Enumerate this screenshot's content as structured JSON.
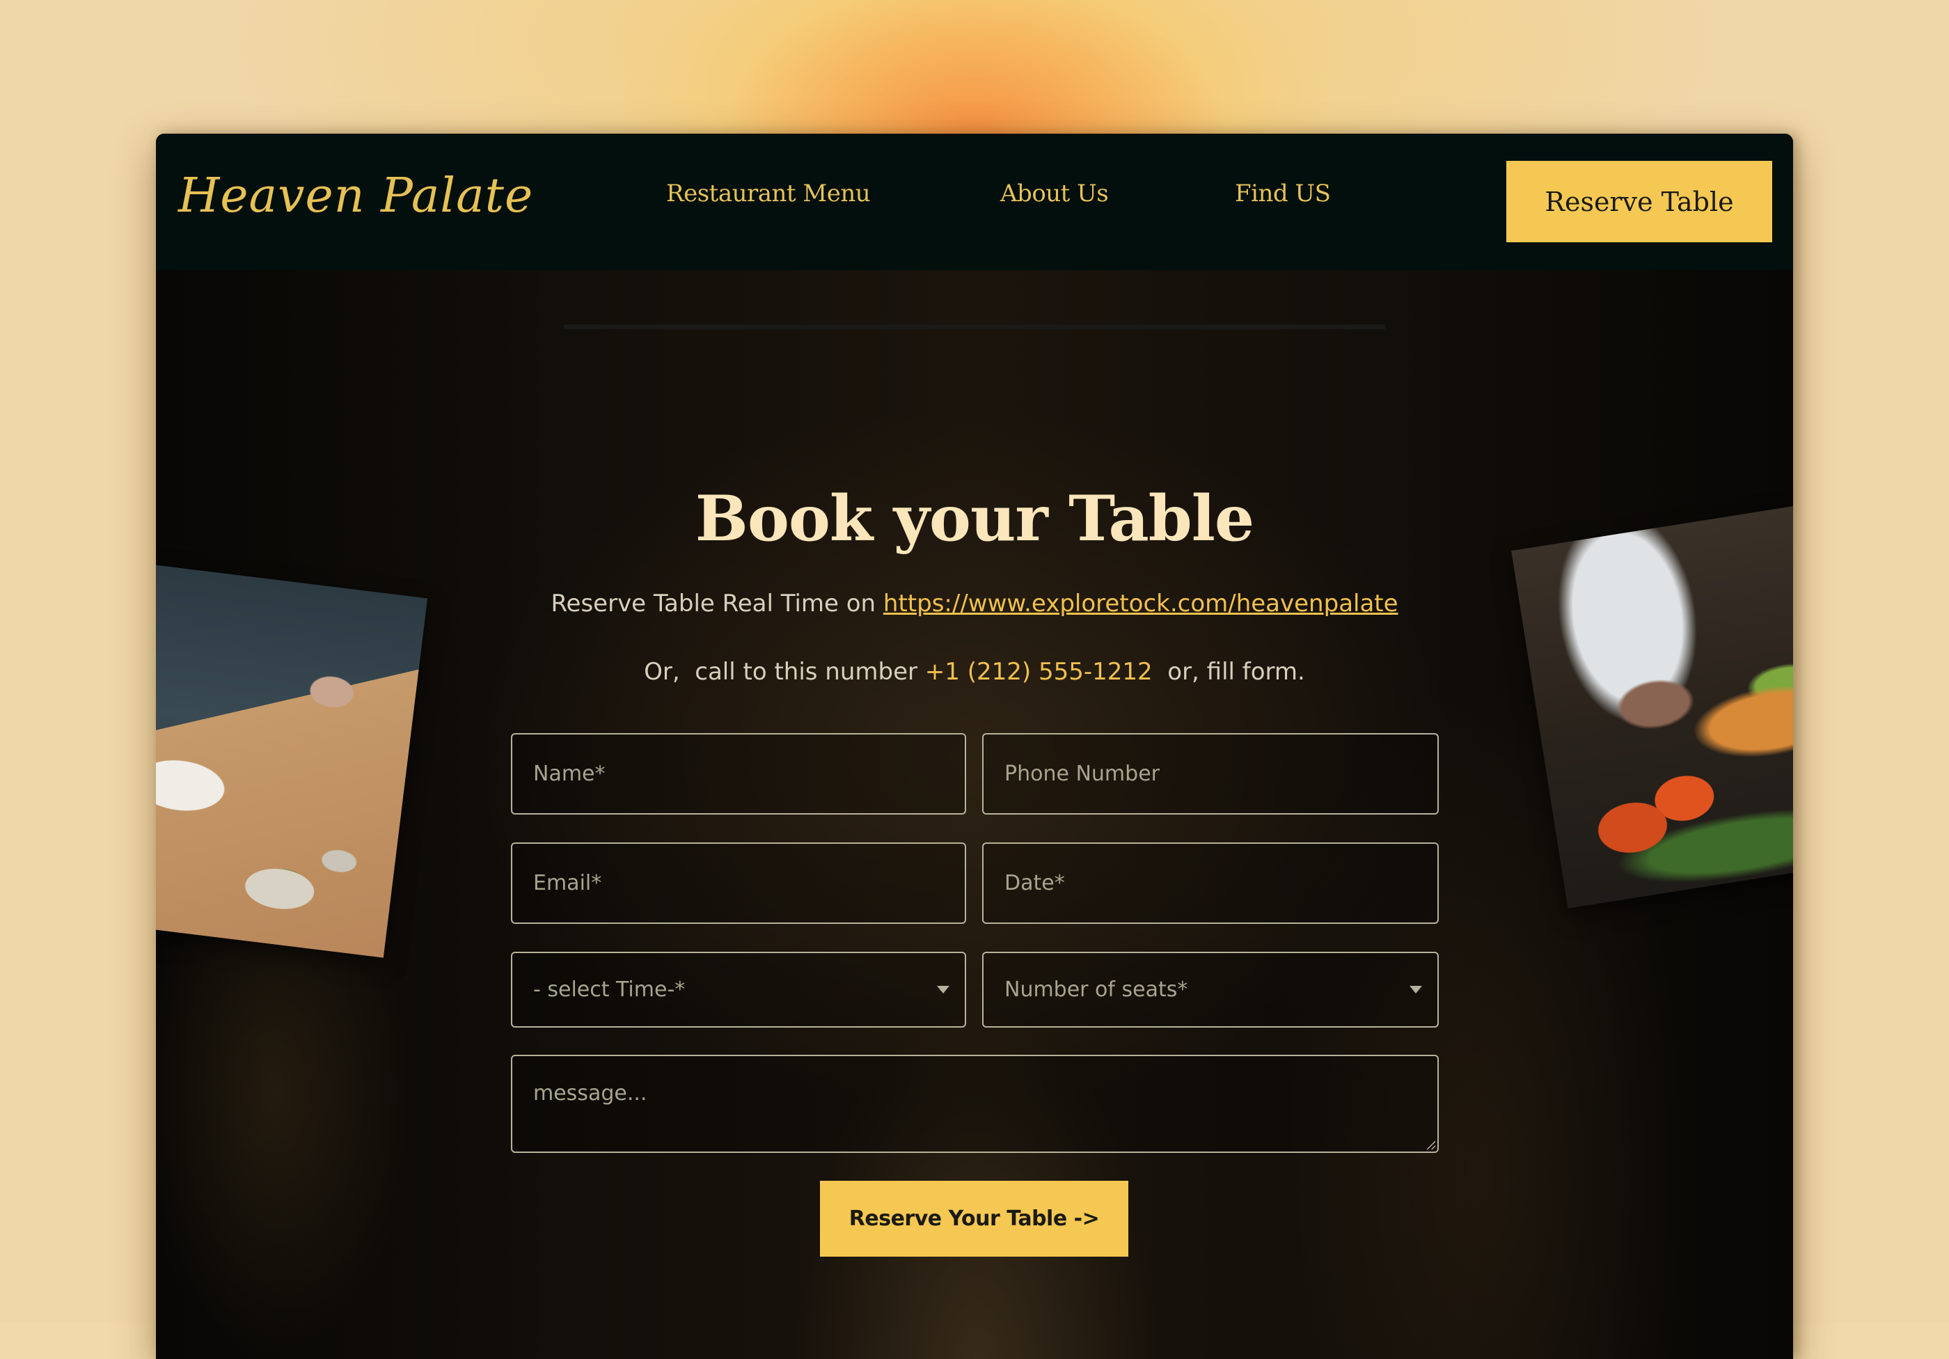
{
  "brand": {
    "logo_text": "Heaven Palate"
  },
  "nav": {
    "links": [
      {
        "label": "Restaurant Menu"
      },
      {
        "label": "About Us"
      },
      {
        "label": "Find US"
      }
    ],
    "cta_label": "Reserve Table"
  },
  "hero": {
    "title": "Book your Table",
    "line1_prefix": "Reserve Table Real Time on ",
    "line1_link": "https://www.exploretock.com/heavenpalate",
    "line2_prefix": "Or,  call to this number ",
    "line2_phone": "+1 (212) 555-1212",
    "line2_suffix": "  or, fill form."
  },
  "form": {
    "name": {
      "placeholder": "Name*",
      "value": ""
    },
    "phone": {
      "placeholder": "Phone Number",
      "value": ""
    },
    "email": {
      "placeholder": "Email*",
      "value": ""
    },
    "date": {
      "placeholder": "Date*",
      "value": ""
    },
    "time": {
      "selected": "- select Time-*"
    },
    "seats": {
      "selected": "Number of seats*"
    },
    "message": {
      "placeholder": "message...",
      "value": ""
    },
    "submit_label": "Reserve Your Table ->"
  },
  "images": {
    "left": "plated-dish-photo",
    "right": "chef-pasta-photo"
  },
  "colors": {
    "accent": "#f4c852",
    "nav_bg": "#030f0c",
    "link": "#f1c14f",
    "title": "#fbe6bb"
  }
}
